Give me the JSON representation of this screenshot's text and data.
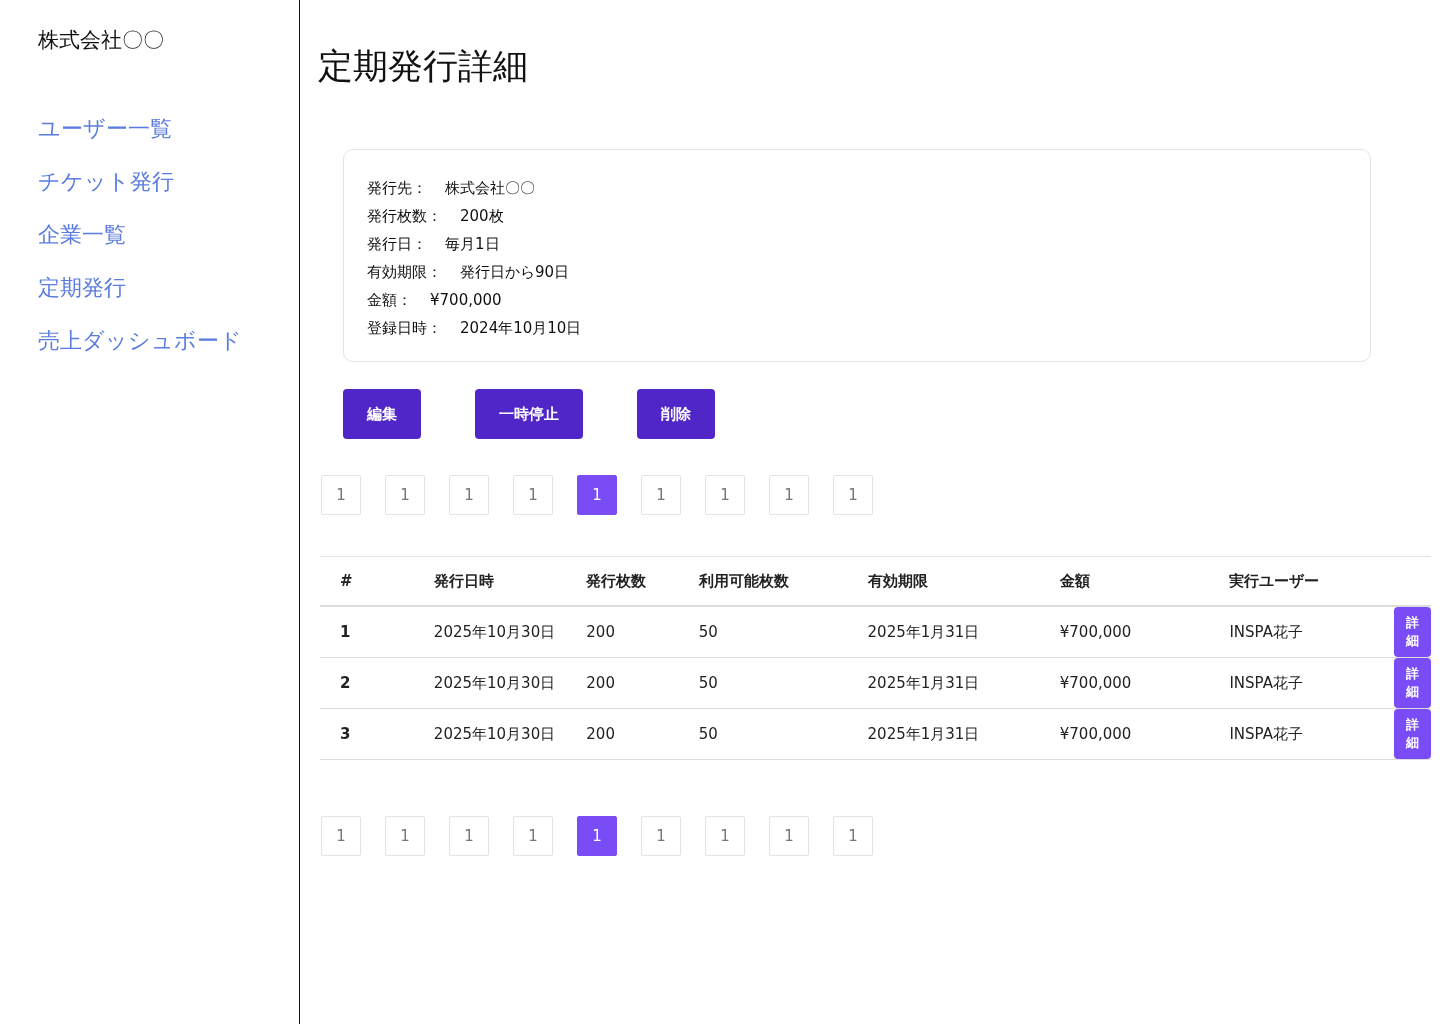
{
  "sidebar": {
    "company": "株式会社〇〇",
    "items": [
      {
        "label": "ユーザー一覧"
      },
      {
        "label": "チケット発行"
      },
      {
        "label": "企業一覧"
      },
      {
        "label": "定期発行"
      },
      {
        "label": "売上ダッシュボード"
      }
    ]
  },
  "page_title": "定期発行詳細",
  "details": [
    {
      "label": "発行先：",
      "value": "株式会社〇〇"
    },
    {
      "label": "発行枚数：",
      "value": "200枚"
    },
    {
      "label": "発行日：",
      "value": "毎月1日"
    },
    {
      "label": "有効期限：",
      "value": "発行日から90日"
    },
    {
      "label": "金額：",
      "value": "¥700,000"
    },
    {
      "label": "登録日時：",
      "value": "2024年10月10日"
    }
  ],
  "buttons": [
    "編集",
    "一時停止",
    "削除"
  ],
  "pagination_top": [
    {
      "label": "1",
      "selected": false
    },
    {
      "label": "1",
      "selected": false
    },
    {
      "label": "1",
      "selected": false
    },
    {
      "label": "1",
      "selected": false
    },
    {
      "label": "1",
      "selected": true
    },
    {
      "label": "1",
      "selected": false
    },
    {
      "label": "1",
      "selected": false
    },
    {
      "label": "1",
      "selected": false
    },
    {
      "label": "1",
      "selected": false
    }
  ],
  "table": {
    "columns": [
      "#",
      "発行日時",
      "発行枚数",
      "利用可能枚数",
      "有効期限",
      "金額",
      "実行ユーザー"
    ],
    "rows": [
      {
        "cells": [
          "1",
          "2025年10月30日",
          "200",
          "50",
          "2025年1月31日",
          "¥700,000",
          "INSPA花子"
        ],
        "action": "詳細"
      },
      {
        "cells": [
          "2",
          "2025年10月30日",
          "200",
          "50",
          "2025年1月31日",
          "¥700,000",
          "INSPA花子"
        ],
        "action": "詳細"
      },
      {
        "cells": [
          "3",
          "2025年10月30日",
          "200",
          "50",
          "2025年1月31日",
          "¥700,000",
          "INSPA花子"
        ],
        "action": "詳細"
      }
    ]
  },
  "pagination_bottom": [
    {
      "label": "1",
      "selected": false
    },
    {
      "label": "1",
      "selected": false
    },
    {
      "label": "1",
      "selected": false
    },
    {
      "label": "1",
      "selected": false
    },
    {
      "label": "1",
      "selected": true
    },
    {
      "label": "1",
      "selected": false
    },
    {
      "label": "1",
      "selected": false
    },
    {
      "label": "1",
      "selected": false
    },
    {
      "label": "1",
      "selected": false
    }
  ]
}
